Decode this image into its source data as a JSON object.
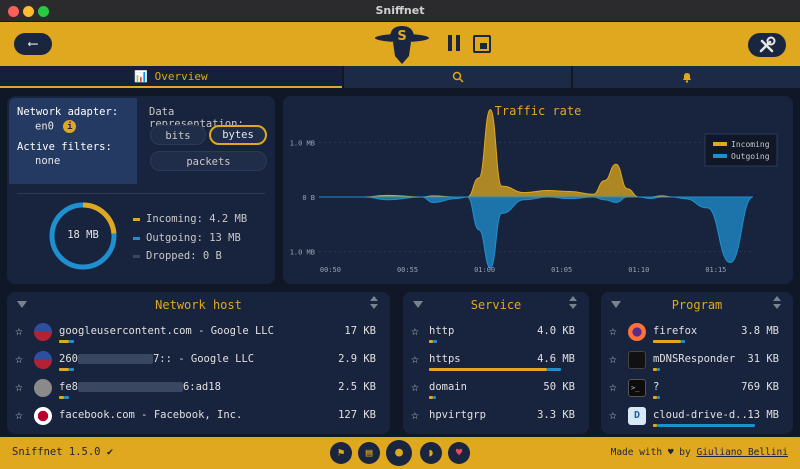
{
  "window": {
    "title": "Sniffnet"
  },
  "tabs": {
    "overview": "Overview"
  },
  "info": {
    "adapter_label": "Network adapter:",
    "adapter_value": "en0",
    "filters_label": "Active filters:",
    "filters_value": "none",
    "datarep_label": "Data representation:",
    "options": [
      "bits",
      "bytes",
      "packets"
    ],
    "selected": "bytes",
    "donut_total": "18 MB",
    "incoming": "Incoming: 4.2 MB",
    "outgoing": "Outgoing: 13 MB",
    "dropped": "Dropped: 0 B"
  },
  "colors": {
    "accent": "#e0a81e",
    "incoming": "#e0a81e",
    "outgoing": "#1f8fd0",
    "bg": "#101828",
    "panel": "#18243d"
  },
  "chart": {
    "title": "Traffic rate",
    "legend_incoming": "Incoming",
    "legend_outgoing": "Outgoing",
    "y_labels": [
      "1.0 MB",
      "0 B",
      "1.0 MB"
    ],
    "x_labels": [
      "00:50",
      "00:55",
      "01:00",
      "01:05",
      "01:10",
      "01:15"
    ]
  },
  "chart_data": {
    "type": "area",
    "title": "Traffic rate",
    "x_ticks": [
      "00:50",
      "00:55",
      "01:00",
      "01:05",
      "01:10",
      "01:15"
    ],
    "y_range": [
      -1.3,
      1.3
    ],
    "y_unit": "MB",
    "series": [
      {
        "name": "Incoming",
        "x": [
          0,
          8,
          12,
          18,
          20,
          24,
          26,
          28,
          30,
          32,
          36,
          40,
          44,
          48,
          50,
          52,
          54,
          56,
          58,
          60,
          62,
          64,
          68,
          72,
          76
        ],
        "values": [
          0,
          0,
          0.03,
          0,
          0.02,
          0,
          0,
          0.35,
          1.6,
          0.2,
          0.08,
          0.12,
          0.1,
          0.05,
          0.3,
          0.6,
          0.15,
          0,
          0,
          0.02,
          0,
          0,
          0,
          0,
          0
        ]
      },
      {
        "name": "Outgoing",
        "x": [
          0,
          8,
          12,
          18,
          20,
          24,
          26,
          28,
          30,
          32,
          36,
          40,
          44,
          48,
          50,
          52,
          54,
          56,
          58,
          60,
          62,
          64,
          68,
          72,
          76
        ],
        "values": [
          0,
          0,
          -0.05,
          0,
          -0.1,
          -0.03,
          0,
          -0.6,
          -1.3,
          -0.3,
          -0.05,
          0,
          -0.03,
          0,
          -0.05,
          -0.1,
          0,
          0,
          -0.03,
          0,
          0,
          -0.03,
          -0.2,
          -1.2,
          0
        ]
      }
    ]
  },
  "tables": {
    "host": {
      "title": "Network host",
      "rows": [
        {
          "name": "googleusercontent.com - Google LLC",
          "value": "17 KB",
          "in": 0.1,
          "out": 0.05
        },
        {
          "prefix": "260",
          "suffix": "7:: - Google LLC",
          "value": "2.9 KB",
          "in": 0.1,
          "out": 0.05
        },
        {
          "prefix": "fe8",
          "suffix": "6:ad18",
          "value": "2.5 KB",
          "in": 0.05,
          "out": 0.05
        },
        {
          "name": "facebook.com - Facebook, Inc.",
          "value": "127 KB",
          "in": 0.1,
          "out": 0.05
        }
      ]
    },
    "service": {
      "title": "Service",
      "rows": [
        {
          "name": "http",
          "value": "4.0 KB",
          "in": 0.06,
          "out": 0.06
        },
        {
          "name": "https",
          "value": "4.6 MB",
          "in": 0.9,
          "out": 0.1
        },
        {
          "name": "domain",
          "value": "50 KB",
          "in": 0.06,
          "out": 0.04
        },
        {
          "name": "hpvirtgrp",
          "value": "3.3 KB",
          "in": 0.04,
          "out": 0.04
        }
      ]
    },
    "program": {
      "title": "Program",
      "rows": [
        {
          "name": "firefox",
          "value": "3.8 MB",
          "in": 0.35,
          "out": 0.05
        },
        {
          "name": "mDNSResponder",
          "value": "31 KB",
          "in": 0.06,
          "out": 0.05
        },
        {
          "name": "?",
          "value": "769 KB",
          "in": 0.05,
          "out": 0.04
        },
        {
          "name": "cloud-drive-d...",
          "value": "13 MB",
          "in": 0.05,
          "out": 0.9
        }
      ]
    }
  },
  "footer": {
    "version": "Sniffnet 1.5.0",
    "version_check": "✔",
    "made_with": "Made with",
    "heart": "♥",
    "by": "by",
    "author": "Giuliano Bellini",
    "icons": [
      "wiki-icon",
      "book-icon",
      "github-icon",
      "rss-icon",
      "sponsor-icon"
    ]
  }
}
